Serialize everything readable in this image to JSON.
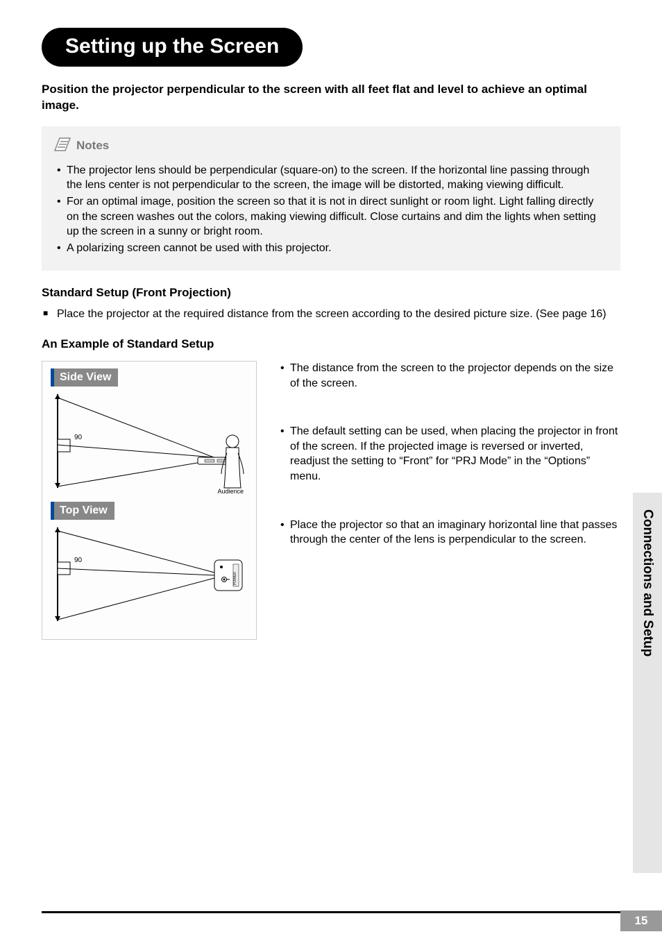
{
  "title": "Setting up the Screen",
  "intro": "Position the projector perpendicular to the screen with all feet flat and level to achieve an optimal image.",
  "notes_label": "Notes",
  "notes": [
    "The projector lens should be perpendicular (square-on) to the screen. If the horizontal line passing through the lens center is not perpendicular to the screen, the image will be distorted, making viewing difficult.",
    "For an optimal image, position the screen so that it is not in direct sunlight or room light. Light falling directly on the screen washes out the colors, making viewing difficult. Close curtains and dim the lights when setting up the screen in a sunny or bright room.",
    "A polarizing screen cannot be used with this projector."
  ],
  "standard_heading": "Standard Setup (Front Projection)",
  "standard_item": "Place the projector at the required distance from the screen according to the desired picture size. (See page 16)",
  "example_heading": "An Example of Standard Setup",
  "diagram": {
    "side_view_label": "Side View",
    "top_view_label": "Top View",
    "angle_label": "90",
    "audience_label": "Audience"
  },
  "example_points": [
    "The distance from the screen to the projector depends on the size of the screen.",
    "The default setting can be used, when placing the projector in front of the screen. If the projected image is reversed or inverted, readjust the setting to “Front” for “PRJ Mode” in the “Options” menu.",
    "Place the projector so that an imaginary horizontal line that passes through the center of the lens is perpendicular to the screen."
  ],
  "side_tab": "Connections and Setup",
  "page_number": "15"
}
